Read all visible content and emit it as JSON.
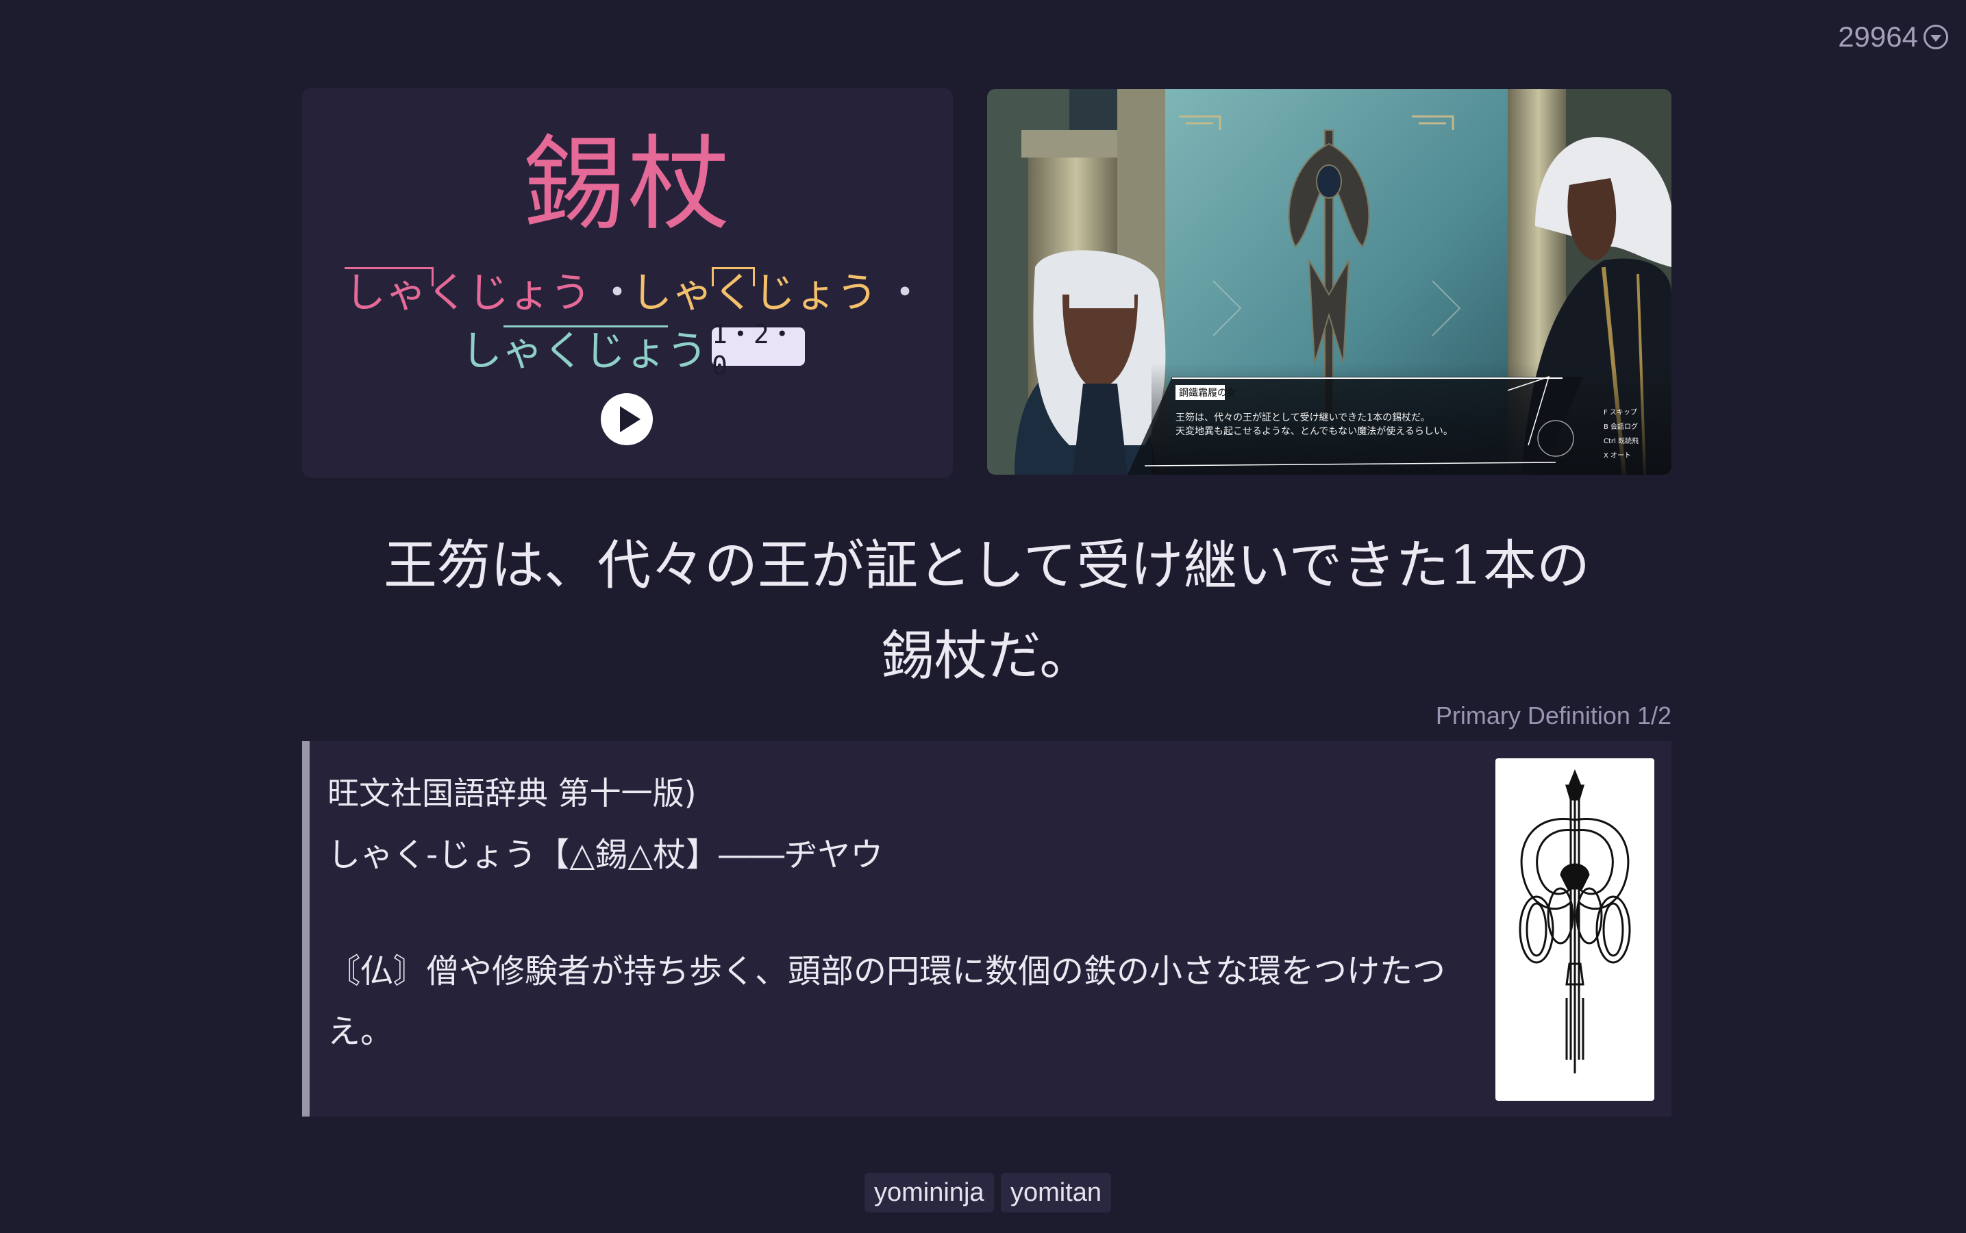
{
  "header": {
    "card_count": "29964"
  },
  "word": {
    "expression": "錫杖",
    "readings": [
      "しゃくじょう",
      "しゃくじょう",
      "しゃくじょう"
    ],
    "separator": "・",
    "pitch_badge": "1・2・0"
  },
  "screenshot": {
    "name_plate": "鋼鐵霜履の女",
    "dialogue_line1": "王笏は、代々の王が証として受け継いできた1本の錫杖だ。",
    "dialogue_line2": "天変地異も起こせるような、とんでもない魔法が使えるらしい。",
    "controls": [
      "F スキップ",
      "B 会話ログ",
      "Ctrl 既読飛",
      "X オート"
    ]
  },
  "sentence": {
    "line1": "王笏は、代々の王が証として受け継いできた1本の",
    "line2": "錫杖だ。"
  },
  "definition": {
    "label": "Primary Definition 1/2",
    "dictionary": "旺文社国語辞典 第十一版)",
    "headword": "しゃく-じょう【△錫△杖】――ヂヤウ",
    "gloss": "〘仏〙僧や修験者が持ち歩く、頭部の円環に数個の鉄の小さな環をつけたつえ。"
  },
  "tags": [
    "yomininja",
    "yomitan"
  ],
  "colors": {
    "background": "#1d1b2e",
    "card": "#25223a",
    "reading1": "#e56a97",
    "reading2": "#f4c06b",
    "reading3": "#8fd0c9"
  }
}
